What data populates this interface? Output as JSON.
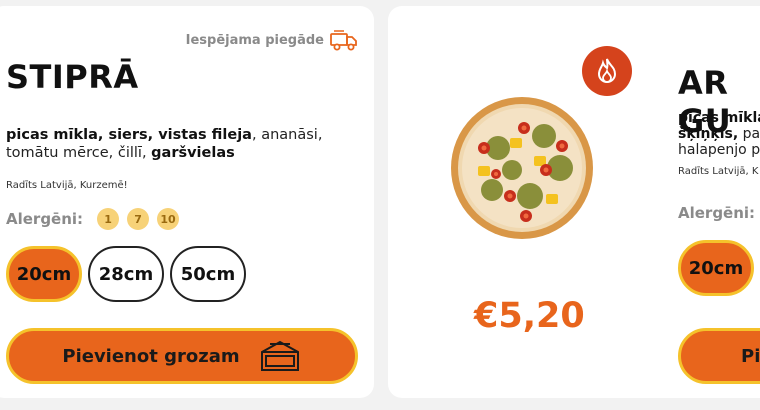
{
  "left_card": {
    "delivery_text": "Iespējama piegāde",
    "title": "STIPRĀ",
    "desc_bold_1": "picas mīkla, siers, vistas fileja",
    "desc_normal_1": ", ananāsi, tomātu mērce, čillī, ",
    "desc_bold_2": "garšvielas",
    "origin": "Radīts Latvijā, Kurzemē!",
    "allergens_label": "Alergēni:",
    "allergens": [
      "1",
      "7",
      "10"
    ],
    "sizes": [
      "20cm",
      "28cm",
      "50cm"
    ],
    "selected_size": "20cm",
    "add_to_cart_label": "Pievienot grozam"
  },
  "right_card": {
    "price": "€5,20",
    "title": "AR GU",
    "desc_bold_1": "picas mīkla",
    "desc_bold_2": "šķiņķis,",
    "desc_normal_2": " pap",
    "desc_normal_3": "halapenjo p",
    "origin": "Radīts Latvijā, K",
    "allergens_label": "Alergēni:",
    "size_selected": "20cm",
    "add_to_cart_partial": "Pie"
  },
  "colors": {
    "accent": "#e8651c",
    "accent_border": "#f5c22b",
    "allergen_chip": "#f7d278",
    "hot": "#d5431c"
  }
}
